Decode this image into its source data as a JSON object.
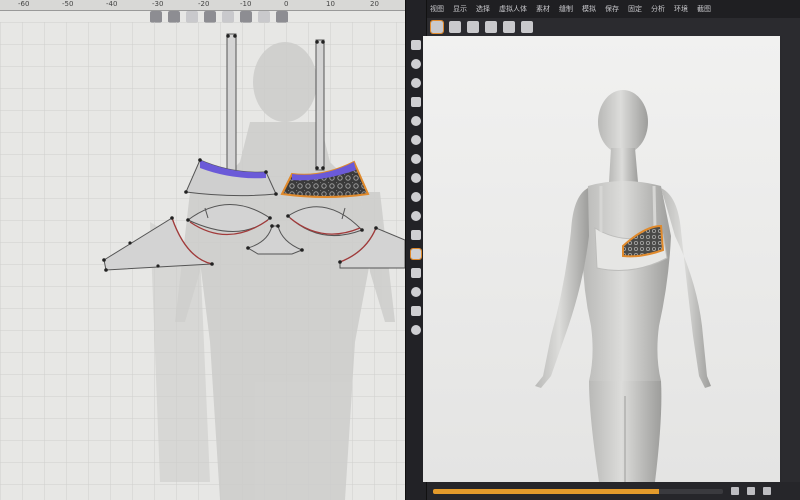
{
  "ruler": {
    "ticks": [
      "-60",
      "-50",
      "-40",
      "-30",
      "-20",
      "-10",
      "0",
      "10",
      "20"
    ]
  },
  "menu": {
    "items": [
      "视图",
      "显示",
      "选择",
      "虚拟人体",
      "素材",
      "缝制",
      "模拟",
      "保存",
      "固定",
      "分析",
      "环境",
      "截图"
    ]
  },
  "icons": {
    "left_toolbar": [
      "pointer-icon",
      "transform-icon",
      "segment-icon",
      "internal-line-icon",
      "pattern-icon",
      "polygon-icon",
      "rectangle-icon",
      "circle-icon"
    ],
    "center_toolbar": [
      "select-mesh-icon",
      "move-icon",
      "rotate-icon",
      "fold-icon",
      "sphere-icon",
      "box-icon",
      "cylinder-icon",
      "tape-icon",
      "pin-icon",
      "sew-icon",
      "avatar-icon",
      "fabric-icon",
      "tack-icon",
      "brush-icon",
      "measure-icon",
      "record-icon"
    ],
    "top3d_toolbar": [
      "home-icon",
      "view-front-icon",
      "view-back-icon",
      "view-left-icon",
      "view-right-icon",
      "view-top-icon"
    ]
  },
  "colors": {
    "accent": "#e08a2c",
    "binding": "#6b5ad8",
    "pattern_fill": "#c9c9c9",
    "seam": "#a23a3a"
  },
  "timeline": {
    "progress": 0.78
  }
}
